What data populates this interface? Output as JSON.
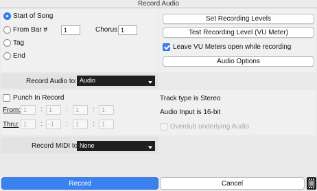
{
  "window": {
    "title": "Record Audio"
  },
  "start": {
    "options": [
      {
        "label": "Start of Song",
        "selected": true
      },
      {
        "label": "From Bar #",
        "selected": false
      },
      {
        "label": "Tag",
        "selected": false
      },
      {
        "label": "End",
        "selected": false
      }
    ],
    "bar_value": "1",
    "chorus_label": "Chorus",
    "chorus_value": "1"
  },
  "levels": {
    "set_levels_label": "Set Recording Levels",
    "test_level_label": "Test Recording Level (VU Meter)",
    "leave_vu_label": "Leave VU Meters open while recording",
    "leave_vu_checked": true,
    "audio_options_label": "Audio Options"
  },
  "record_audio": {
    "label": "Record Audio to:",
    "value": "Audio"
  },
  "punch": {
    "label": "Punch In Record",
    "checked": false,
    "from_label": "From:",
    "thru_label": "Thru:",
    "from_values": [
      "1",
      "1",
      "1",
      "1"
    ],
    "thru_values": [
      "1",
      "-1",
      "1",
      "1"
    ]
  },
  "info": {
    "track_type": "Track type is Stereo",
    "audio_input": "Audio Input is 16-bit",
    "overdub_label": "Overdub underlying Audio",
    "overdub_checked": false
  },
  "record_midi": {
    "label": "Record MIDI to:",
    "value": "None"
  },
  "footer": {
    "record_label": "Record",
    "cancel_label": "Cancel",
    "accent": "#3b82f0"
  }
}
